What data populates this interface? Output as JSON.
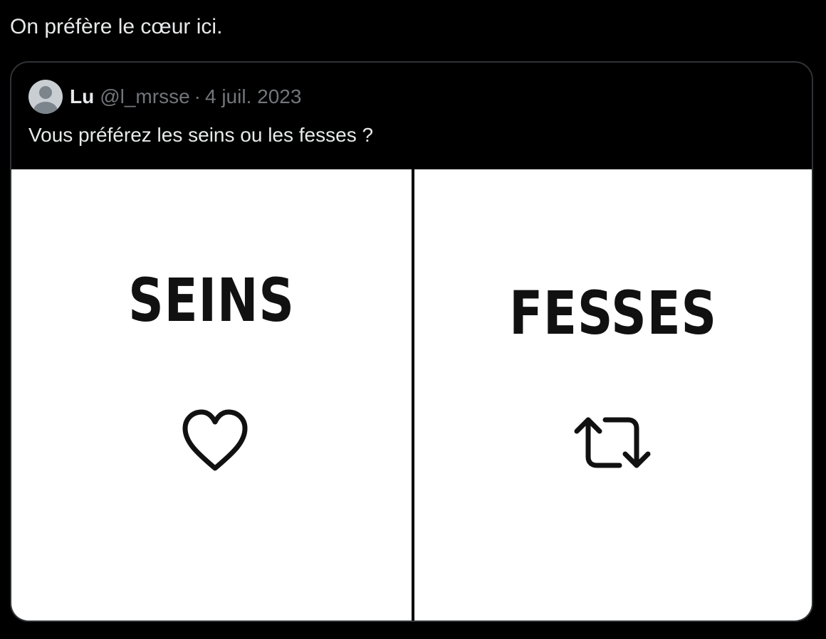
{
  "post": {
    "text": "On préfère le cœur ici."
  },
  "quote": {
    "author_name": "Lu",
    "author_handle": "@l_mrsse",
    "separator": "·",
    "date": "4 juil. 2023",
    "text": "Vous préférez les seins ou les fesses ?"
  },
  "media": {
    "left_panel": {
      "label": "SEINS",
      "icon": "heart-icon"
    },
    "right_panel": {
      "label": "FESSES",
      "icon": "retweet-icon"
    }
  },
  "colors": {
    "background": "#000000",
    "primary_text": "#e7e9ea",
    "secondary_text": "#71767b",
    "card_border": "#2f3336",
    "media_background": "#ffffff",
    "media_text": "#111111"
  }
}
